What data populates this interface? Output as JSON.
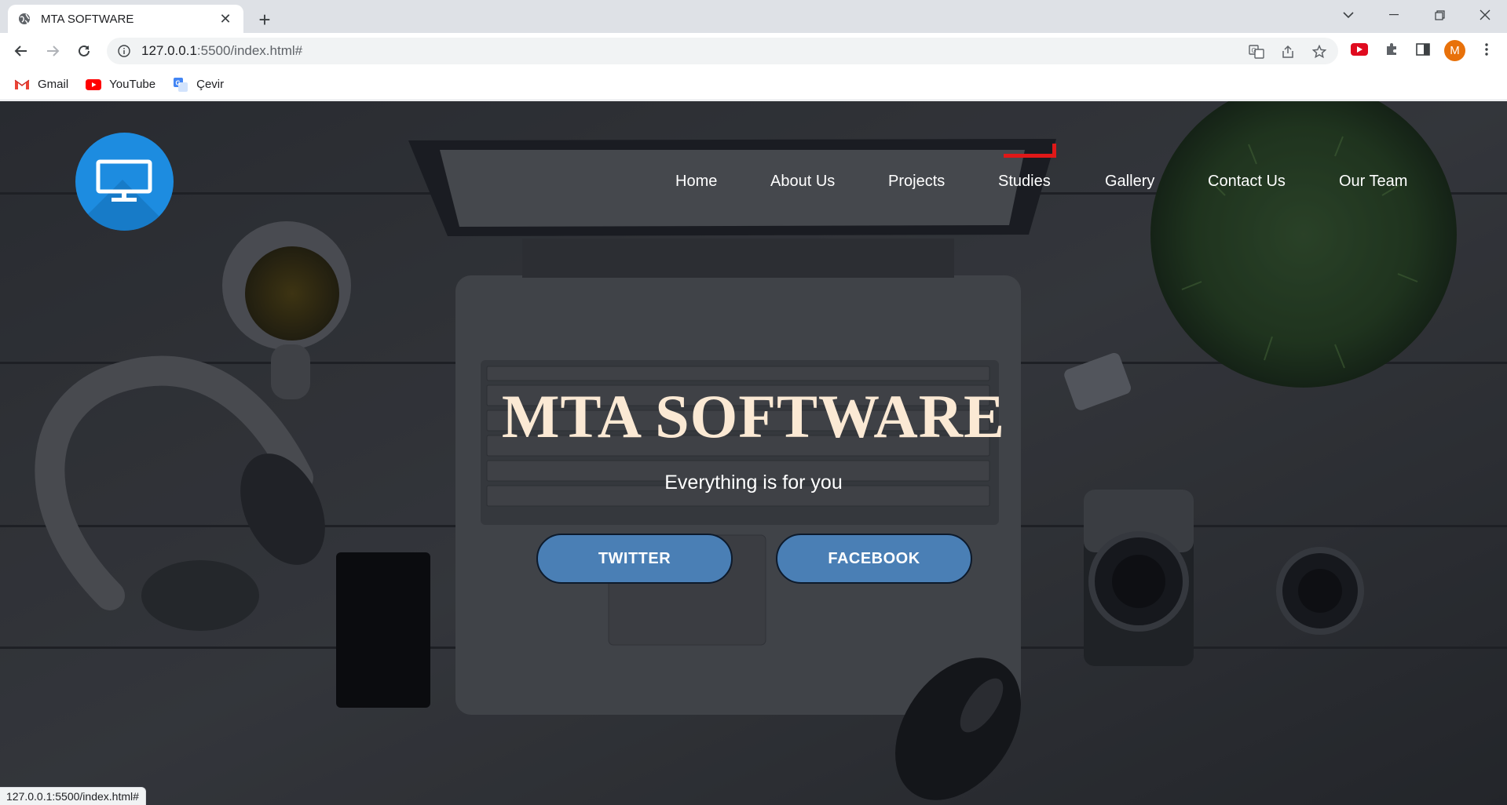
{
  "browser": {
    "tab_title": "MTA SOFTWARE",
    "url_host": "127.0.0.1",
    "url_path": ":5500/index.html#",
    "avatar_letter": "M",
    "bookmarks": [
      {
        "label": "Gmail",
        "icon": "gmail-icon"
      },
      {
        "label": "YouTube",
        "icon": "youtube-icon"
      },
      {
        "label": "Çevir",
        "icon": "translate-icon"
      }
    ],
    "status_url": "127.0.0.1:5500/index.html#"
  },
  "site": {
    "logo_icon": "monitor-icon",
    "nav": [
      "Home",
      "About Us",
      "Projects",
      "Studies",
      "Gallery",
      "Contact Us",
      "Our Team"
    ],
    "active_nav": "Studies",
    "hero_title": "MTA SOFTWARE",
    "hero_subtitle": "Everything is for you",
    "buttons": {
      "twitter": "TWITTER",
      "facebook": "FACEBOOK"
    }
  },
  "colors": {
    "logo_bg": "#1d8ce0",
    "title": "#fbe9d4",
    "button_bg": "#4a7fb5",
    "underline": "#e01818"
  }
}
